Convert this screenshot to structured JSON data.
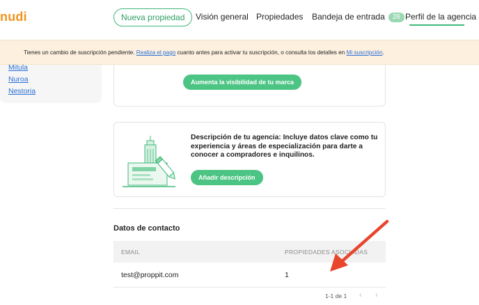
{
  "header": {
    "logo": "nudi",
    "new_property": "Nueva propiedad",
    "nav": [
      "Visión general",
      "Propiedades",
      "Bandeja de entrada",
      "Perfil de la agencia"
    ],
    "inbox_count": "26"
  },
  "banner": {
    "text_before": "Tienes un cambio de suscripción pendiente. ",
    "link_pay": "Realiza el pago",
    "text_middle": " cuanto antes para activar tu suscripción, o consulta los detalles en ",
    "link_sub": "Mi suscripción",
    "text_end": "."
  },
  "sidebar": {
    "links": [
      "Mitula",
      "Nuroa",
      "Nestoria"
    ]
  },
  "brand_card": {
    "button": "Aumenta la visibilidad de tu marca"
  },
  "description_card": {
    "text": "Descripción de tu agencia: Incluye datos clave como tu experiencia y áreas de especialización para darte a conocer a compradores e inquilinos.",
    "button": "Añadir descripción",
    "illustration_icon": "laptop-building-pencil-icon"
  },
  "contact": {
    "title": "Datos de contacto",
    "columns": [
      "EMAIL",
      "PROPIEDADES ASOCIADAS"
    ],
    "rows": [
      {
        "email": "test@proppit.com",
        "properties": "1"
      }
    ],
    "pagination": "1-1 de 1",
    "prev_icon": "chevron-left-icon",
    "next_icon": "chevron-right-icon"
  },
  "colors": {
    "brand": "#f0941e",
    "accent": "#4cc483",
    "banner_bg": "#fdf0df",
    "annotation_arrow": "#e8452c"
  }
}
